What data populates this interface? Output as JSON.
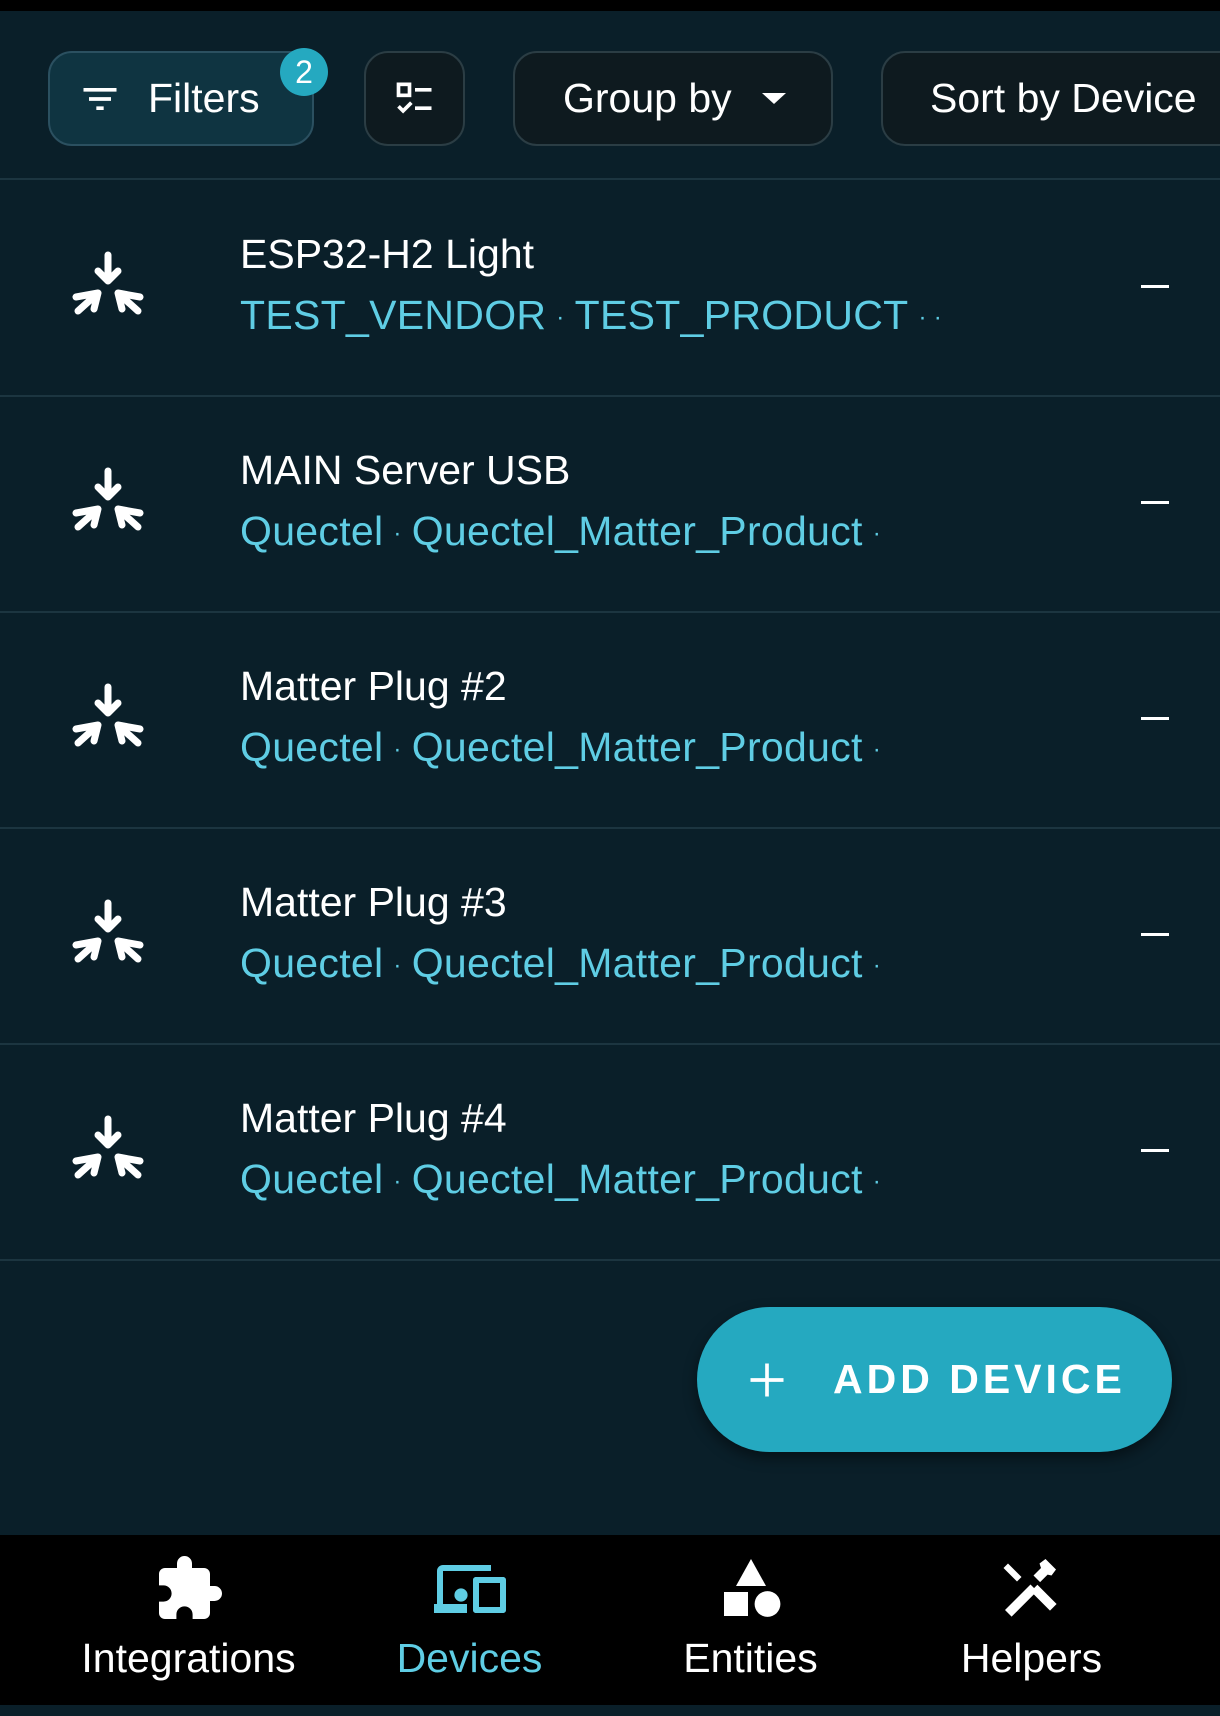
{
  "toolbar": {
    "filters_label": "Filters",
    "filters_count": "2",
    "group_by_label": "Group by",
    "sort_label": "Sort by Device"
  },
  "devices": [
    {
      "name": "ESP32-H2 Light",
      "manufacturer": "TEST_VENDOR",
      "model": "TEST_PRODUCT",
      "trail": "· ·",
      "status": "—"
    },
    {
      "name": "MAIN Server USB",
      "manufacturer": "Quectel",
      "model": "Quectel_Matter_Product",
      "trail": "·",
      "status": "—"
    },
    {
      "name": "Matter Plug #2",
      "manufacturer": "Quectel",
      "model": "Quectel_Matter_Product",
      "trail": "·",
      "status": "—"
    },
    {
      "name": "Matter Plug #3",
      "manufacturer": "Quectel",
      "model": "Quectel_Matter_Product",
      "trail": "·",
      "status": "—"
    },
    {
      "name": "Matter Plug #4",
      "manufacturer": "Quectel",
      "model": "Quectel_Matter_Product",
      "trail": "·",
      "status": "—"
    }
  ],
  "fab": {
    "label": "ADD DEVICE",
    "icon": "plus-icon"
  },
  "nav": [
    {
      "label": "Integrations",
      "icon": "puzzle-icon",
      "active": false
    },
    {
      "label": "Devices",
      "icon": "devices-icon",
      "active": true
    },
    {
      "label": "Entities",
      "icon": "shapes-icon",
      "active": false
    },
    {
      "label": "Helpers",
      "icon": "tools-icon",
      "active": false
    }
  ],
  "colors": {
    "background": "#0a1f29",
    "accent": "#25a9c0",
    "link": "#5fcde4",
    "nav_bg": "#000000"
  }
}
